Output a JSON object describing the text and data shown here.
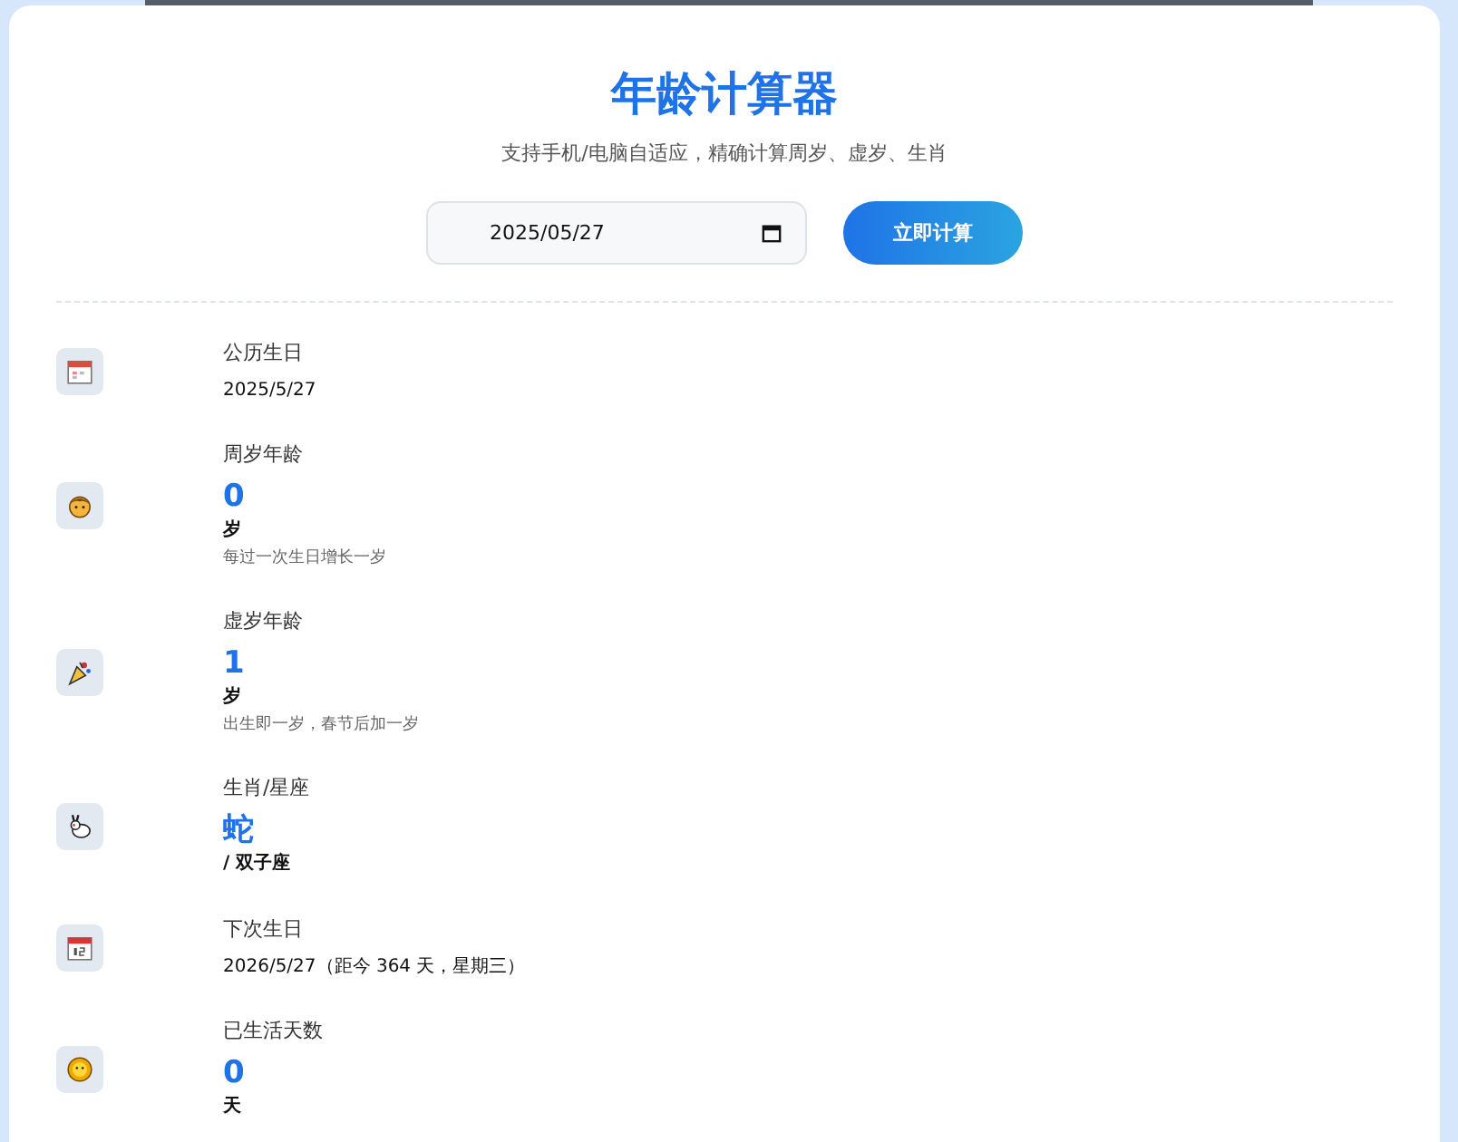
{
  "title": "年龄计算器",
  "subtitle": "支持手机/电脑自适应，精确计算周岁、虚岁、生肖",
  "date_field": {
    "value": "2025/05/27"
  },
  "calculate_button": "立即计算",
  "results": [
    {
      "kind": "text",
      "label": "公历生日",
      "value": "2025/5/27"
    },
    {
      "kind": "number",
      "label": "周岁年龄",
      "value": "0",
      "unit": "岁",
      "note": "每过一次生日增长一岁"
    },
    {
      "kind": "number",
      "label": "虚岁年龄",
      "value": "1",
      "unit": "岁",
      "note": "出生即一岁，春节后加一岁"
    },
    {
      "kind": "number",
      "label": "生肖/星座",
      "value": "蛇",
      "unit": "/ 双子座"
    },
    {
      "kind": "text",
      "label": "下次生日",
      "value": "2026/5/27（距今 364 天，星期三）"
    },
    {
      "kind": "number",
      "label": "已生活天数",
      "value": "0",
      "unit": "天"
    }
  ]
}
